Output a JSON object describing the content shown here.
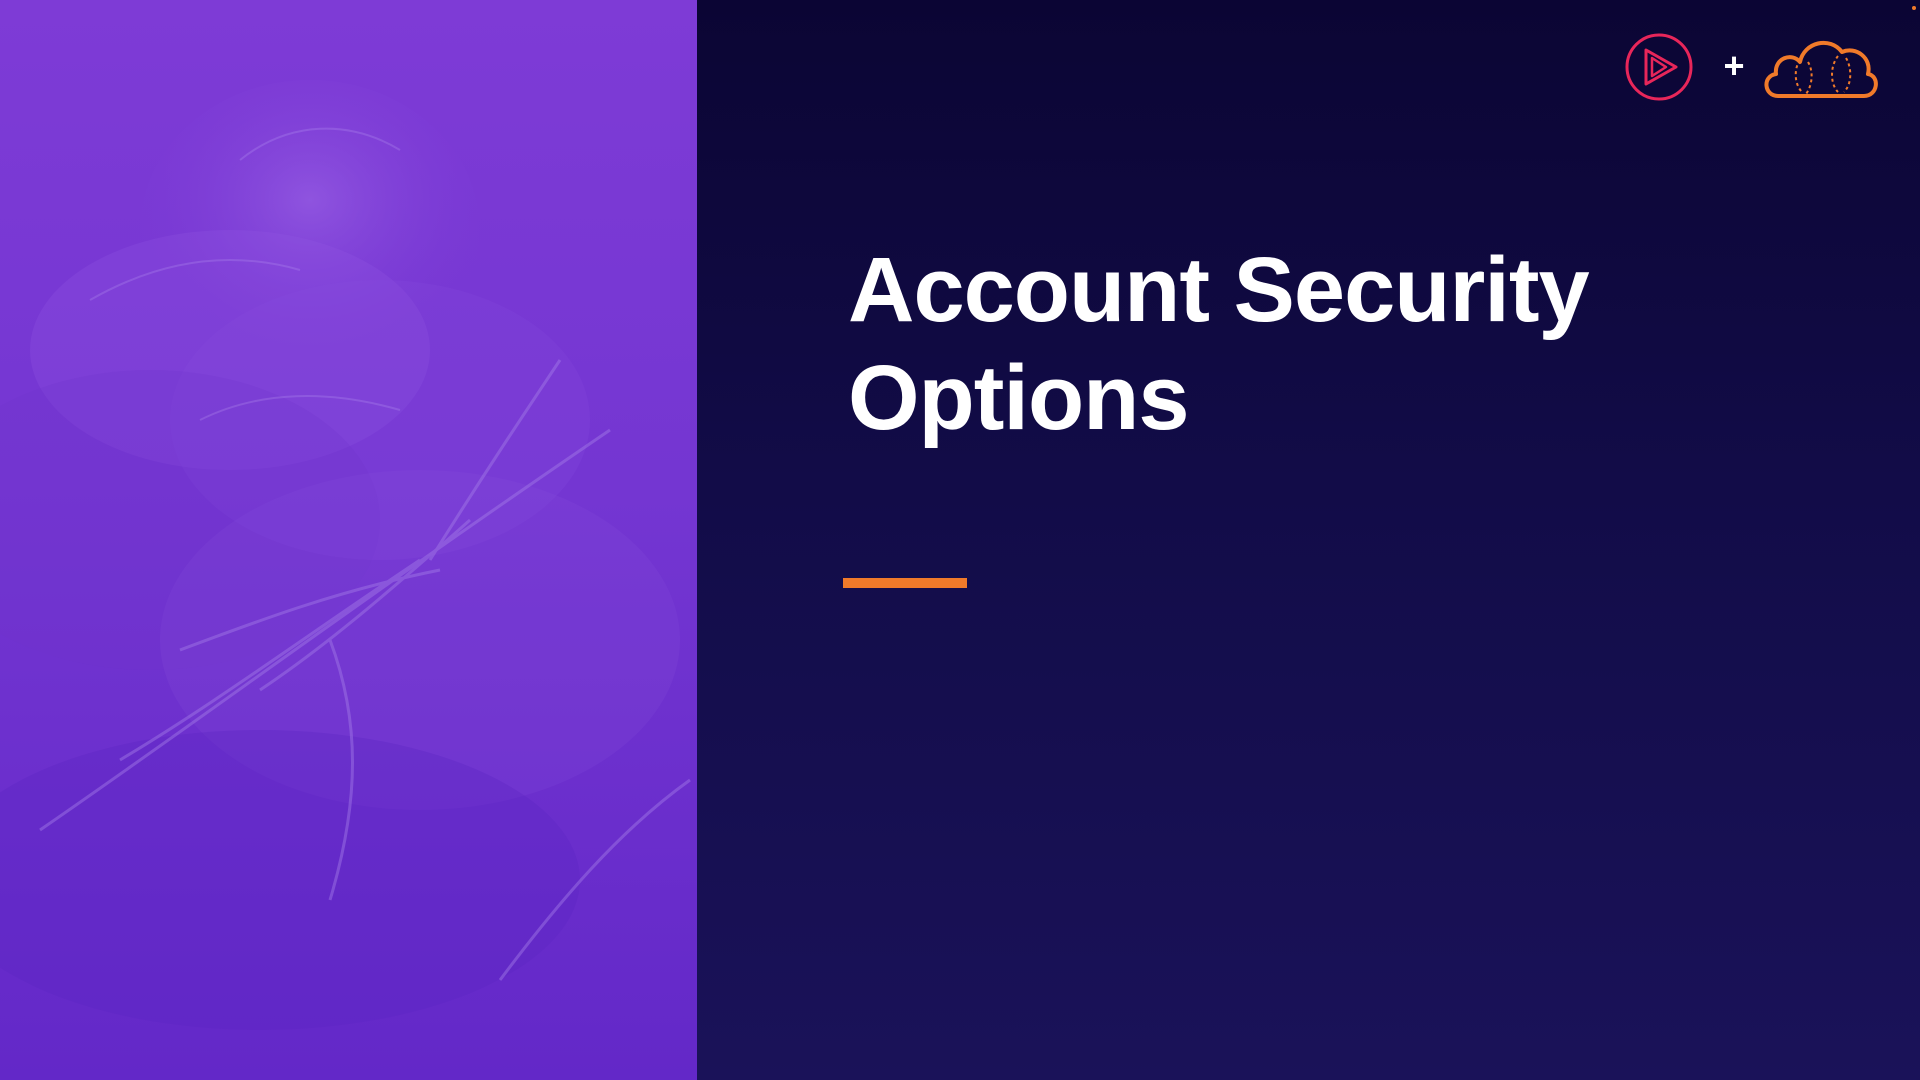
{
  "slide": {
    "title_lines": [
      "Account Security",
      "Options"
    ],
    "logo_separator": "+",
    "icons": {
      "presenter_logo": "play-circle-icon",
      "partner_logo": "cloud-icon"
    },
    "colors": {
      "left_panel": "#7436d2",
      "background": "#120c48",
      "title_text": "#ffffff",
      "accent": "#f07a2a",
      "play_logo": "#e8265a",
      "cloud_logo": "#f07a2a"
    }
  }
}
